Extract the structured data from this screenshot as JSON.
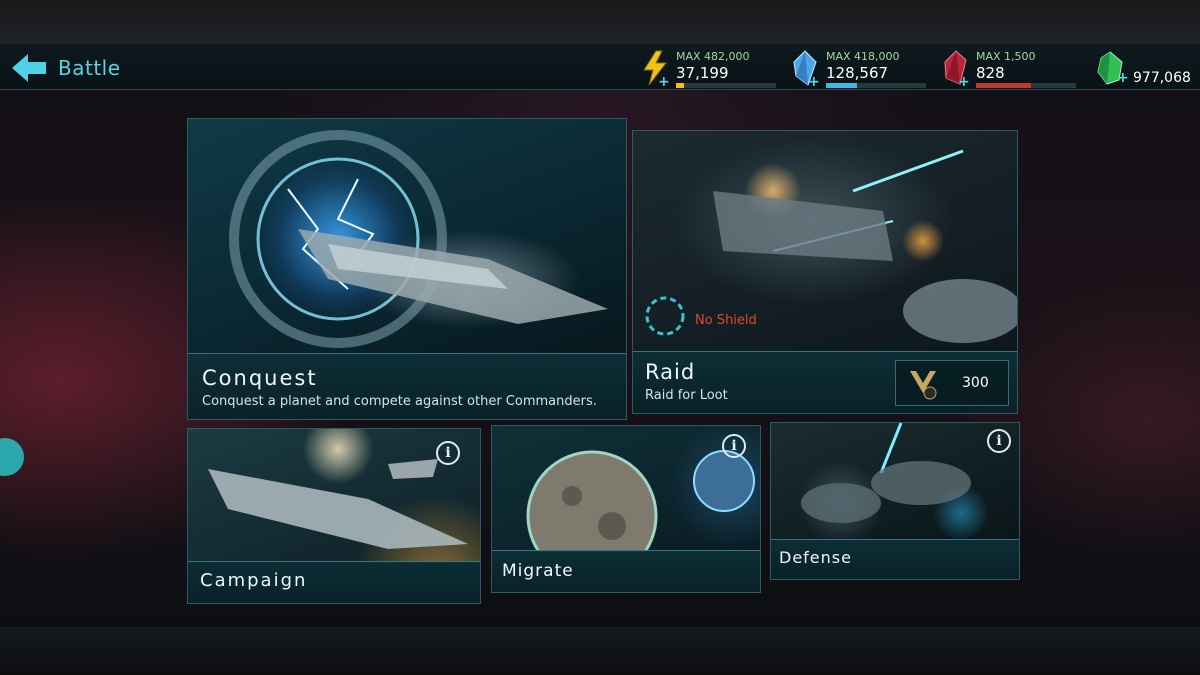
{
  "header": {
    "back_label": "Battle",
    "resources": [
      {
        "name": "energy",
        "icon": "lightning-crystal-icon",
        "max": "MAX 482,000",
        "value": "37,199",
        "fill": 0.077,
        "color": "#f2c21a"
      },
      {
        "name": "crystal",
        "icon": "blue-crystal-icon",
        "max": "MAX 418,000",
        "value": "128,567",
        "fill": 0.307,
        "color": "#3fb7e6"
      },
      {
        "name": "ruby",
        "icon": "red-crystal-icon",
        "max": "MAX 1,500",
        "value": "828",
        "fill": 0.55,
        "color": "#c0392b"
      },
      {
        "name": "gems",
        "icon": "green-gem-icon",
        "value": "977,068"
      }
    ]
  },
  "modes": {
    "conquest": {
      "title": "Conquest",
      "subtitle": "Conquest a planet and compete against other Commanders."
    },
    "raid": {
      "title": "Raid",
      "subtitle": "Raid for Loot",
      "status": "No Shield",
      "cost": "300",
      "cost_icon": "rank-badge-icon"
    },
    "campaign": {
      "title": "Campaign",
      "info": "i"
    },
    "migrate": {
      "title": "Migrate",
      "info": "i"
    },
    "defense": {
      "title": "Defense",
      "info": "i"
    }
  },
  "colors": {
    "accent": "#5ad3e4",
    "no_shield": "#e0462e"
  }
}
